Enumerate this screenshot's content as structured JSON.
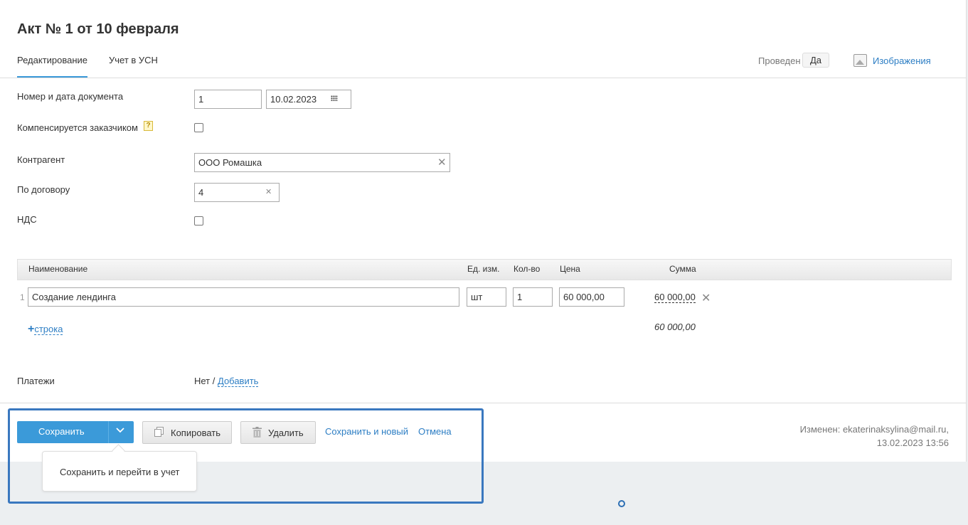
{
  "page": {
    "title": "Акт № 1 от 10 февраля"
  },
  "tabs": [
    {
      "label": "Редактирование",
      "active": true
    },
    {
      "label": "Учет в УСН",
      "active": false
    }
  ],
  "header_right": {
    "posted_label": "Проведен",
    "posted_value": "Да",
    "images_link": "Изображения",
    "images_icon": "image-icon"
  },
  "form": {
    "doc_number_label": "Номер и дата документа",
    "doc_number_value": "1",
    "doc_date_value": "10.02.2023",
    "compensated_label": "Компенсируется заказчиком",
    "compensated_checked": false,
    "help_glyph": "?",
    "counterparty_label": "Контрагент",
    "counterparty_value": "ООО Ромашка",
    "contract_label": "По договору",
    "contract_value": "4",
    "vat_label": "НДС",
    "vat_checked": false
  },
  "table": {
    "headers": {
      "name": "Наименование",
      "unit": "Ед. изм.",
      "qty": "Кол-во",
      "price": "Цена",
      "sum": "Сумма"
    },
    "rows": [
      {
        "num": "1",
        "name": "Создание лендинга",
        "unit": "шт",
        "qty": "1",
        "price": "60 000,00",
        "sum": "60 000,00"
      }
    ],
    "add_row_plus": "+",
    "add_row_label": "строка",
    "total": "60 000,00"
  },
  "payments": {
    "label": "Платежи",
    "value": "Нет /",
    "add_link": "Добавить"
  },
  "actions": {
    "save": "Сохранить",
    "copy": "Копировать",
    "delete": "Удалить",
    "save_and_new": "Сохранить и новый",
    "cancel": "Отмена",
    "dropdown_item": "Сохранить и перейти в учет"
  },
  "modified": {
    "line1": "Изменен: ekaterinaksylina@mail.ru,",
    "line2": "13.02.2023 13:56"
  },
  "colors": {
    "accent": "#3b9ad9",
    "link": "#2d7ec4",
    "highlight": "#3a78bf"
  }
}
